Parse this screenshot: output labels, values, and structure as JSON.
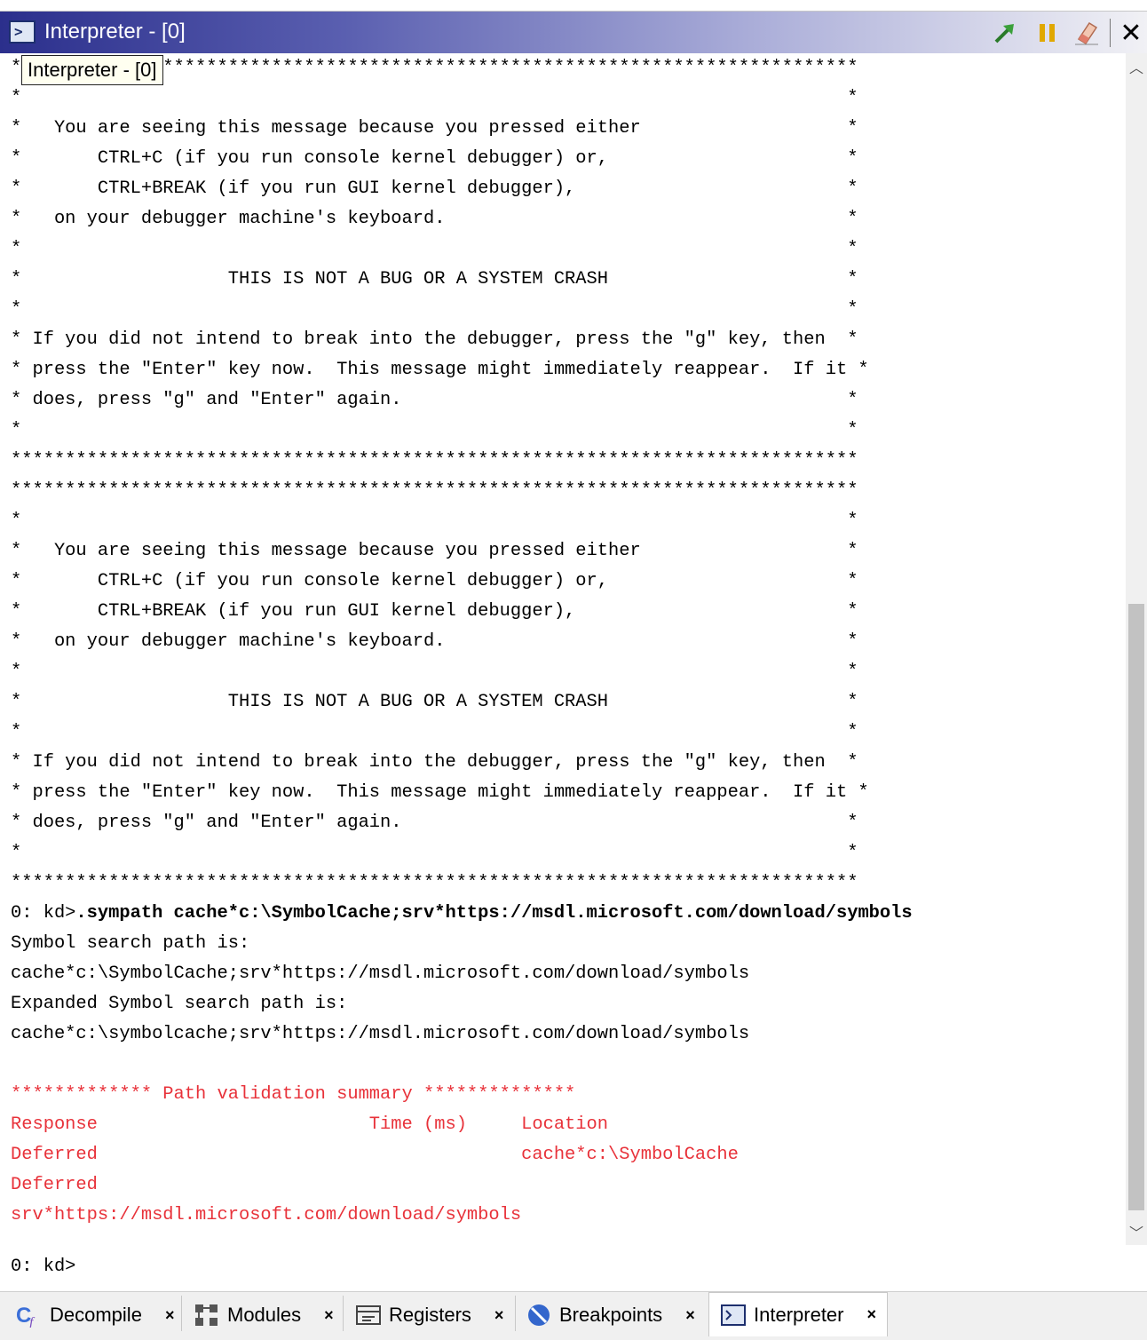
{
  "window": {
    "title": "Interpreter - [0]",
    "tooltip": "Interpreter - [0]",
    "icons": [
      "console-window-icon",
      "run-arrow-icon",
      "pause-icon",
      "clear-eraser-icon",
      "close-icon"
    ]
  },
  "console": {
    "lines": [
      "******************************************************************************",
      "*                                                                            *",
      "*   You are seeing this message because you pressed either                   *",
      "*       CTRL+C (if you run console kernel debugger) or,                      *",
      "*       CTRL+BREAK (if you run GUI kernel debugger),                         *",
      "*   on your debugger machine's keyboard.                                     *",
      "*                                                                            *",
      "*                   THIS IS NOT A BUG OR A SYSTEM CRASH                      *",
      "*                                                                            *",
      "* If you did not intend to break into the debugger, press the \"g\" key, then  *",
      "* press the \"Enter\" key now.  This message might immediately reappear.  If it *",
      "* does, press \"g\" and \"Enter\" again.                                         *",
      "*                                                                            *",
      "******************************************************************************",
      "******************************************************************************",
      "*                                                                            *",
      "*   You are seeing this message because you pressed either                   *",
      "*       CTRL+C (if you run console kernel debugger) or,                      *",
      "*       CTRL+BREAK (if you run GUI kernel debugger),                         *",
      "*   on your debugger machine's keyboard.                                     *",
      "*                                                                            *",
      "*                   THIS IS NOT A BUG OR A SYSTEM CRASH                      *",
      "*                                                                            *",
      "* If you did not intend to break into the debugger, press the \"g\" key, then  *",
      "* press the \"Enter\" key now.  This message might immediately reappear.  If it *",
      "* does, press \"g\" and \"Enter\" again.                                         *",
      "*                                                                            *",
      "******************************************************************************"
    ],
    "command_prompt": "0: kd>",
    "command": ".sympath cache*c:\\SymbolCache;srv*https://msdl.microsoft.com/download/symbols",
    "output": [
      "Symbol search path is:",
      "cache*c:\\SymbolCache;srv*https://msdl.microsoft.com/download/symbols",
      "Expanded Symbol search path is:",
      "cache*c:\\symbolcache;srv*https://msdl.microsoft.com/download/symbols",
      ""
    ],
    "validation": [
      "************* Path validation summary **************",
      "Response                         Time (ms)     Location",
      "Deferred                                       cache*c:\\SymbolCache",
      "Deferred",
      "srv*https://msdl.microsoft.com/download/symbols"
    ],
    "current_prompt": "0: kd>"
  },
  "tabs": [
    {
      "label": "Decompile",
      "icon": "decompile-icon",
      "close": "×",
      "active": false
    },
    {
      "label": "Modules",
      "icon": "modules-icon",
      "close": "×",
      "active": false
    },
    {
      "label": "Registers",
      "icon": "registers-icon",
      "close": "×",
      "active": false
    },
    {
      "label": "Breakpoints",
      "icon": "breakpoints-icon",
      "close": "×",
      "active": false
    },
    {
      "label": "Interpreter",
      "icon": "interpreter-icon",
      "close": "×",
      "active": true
    }
  ],
  "colors": {
    "error_text": "#e8323a",
    "title_gradient_start": "#2b2f8c"
  }
}
